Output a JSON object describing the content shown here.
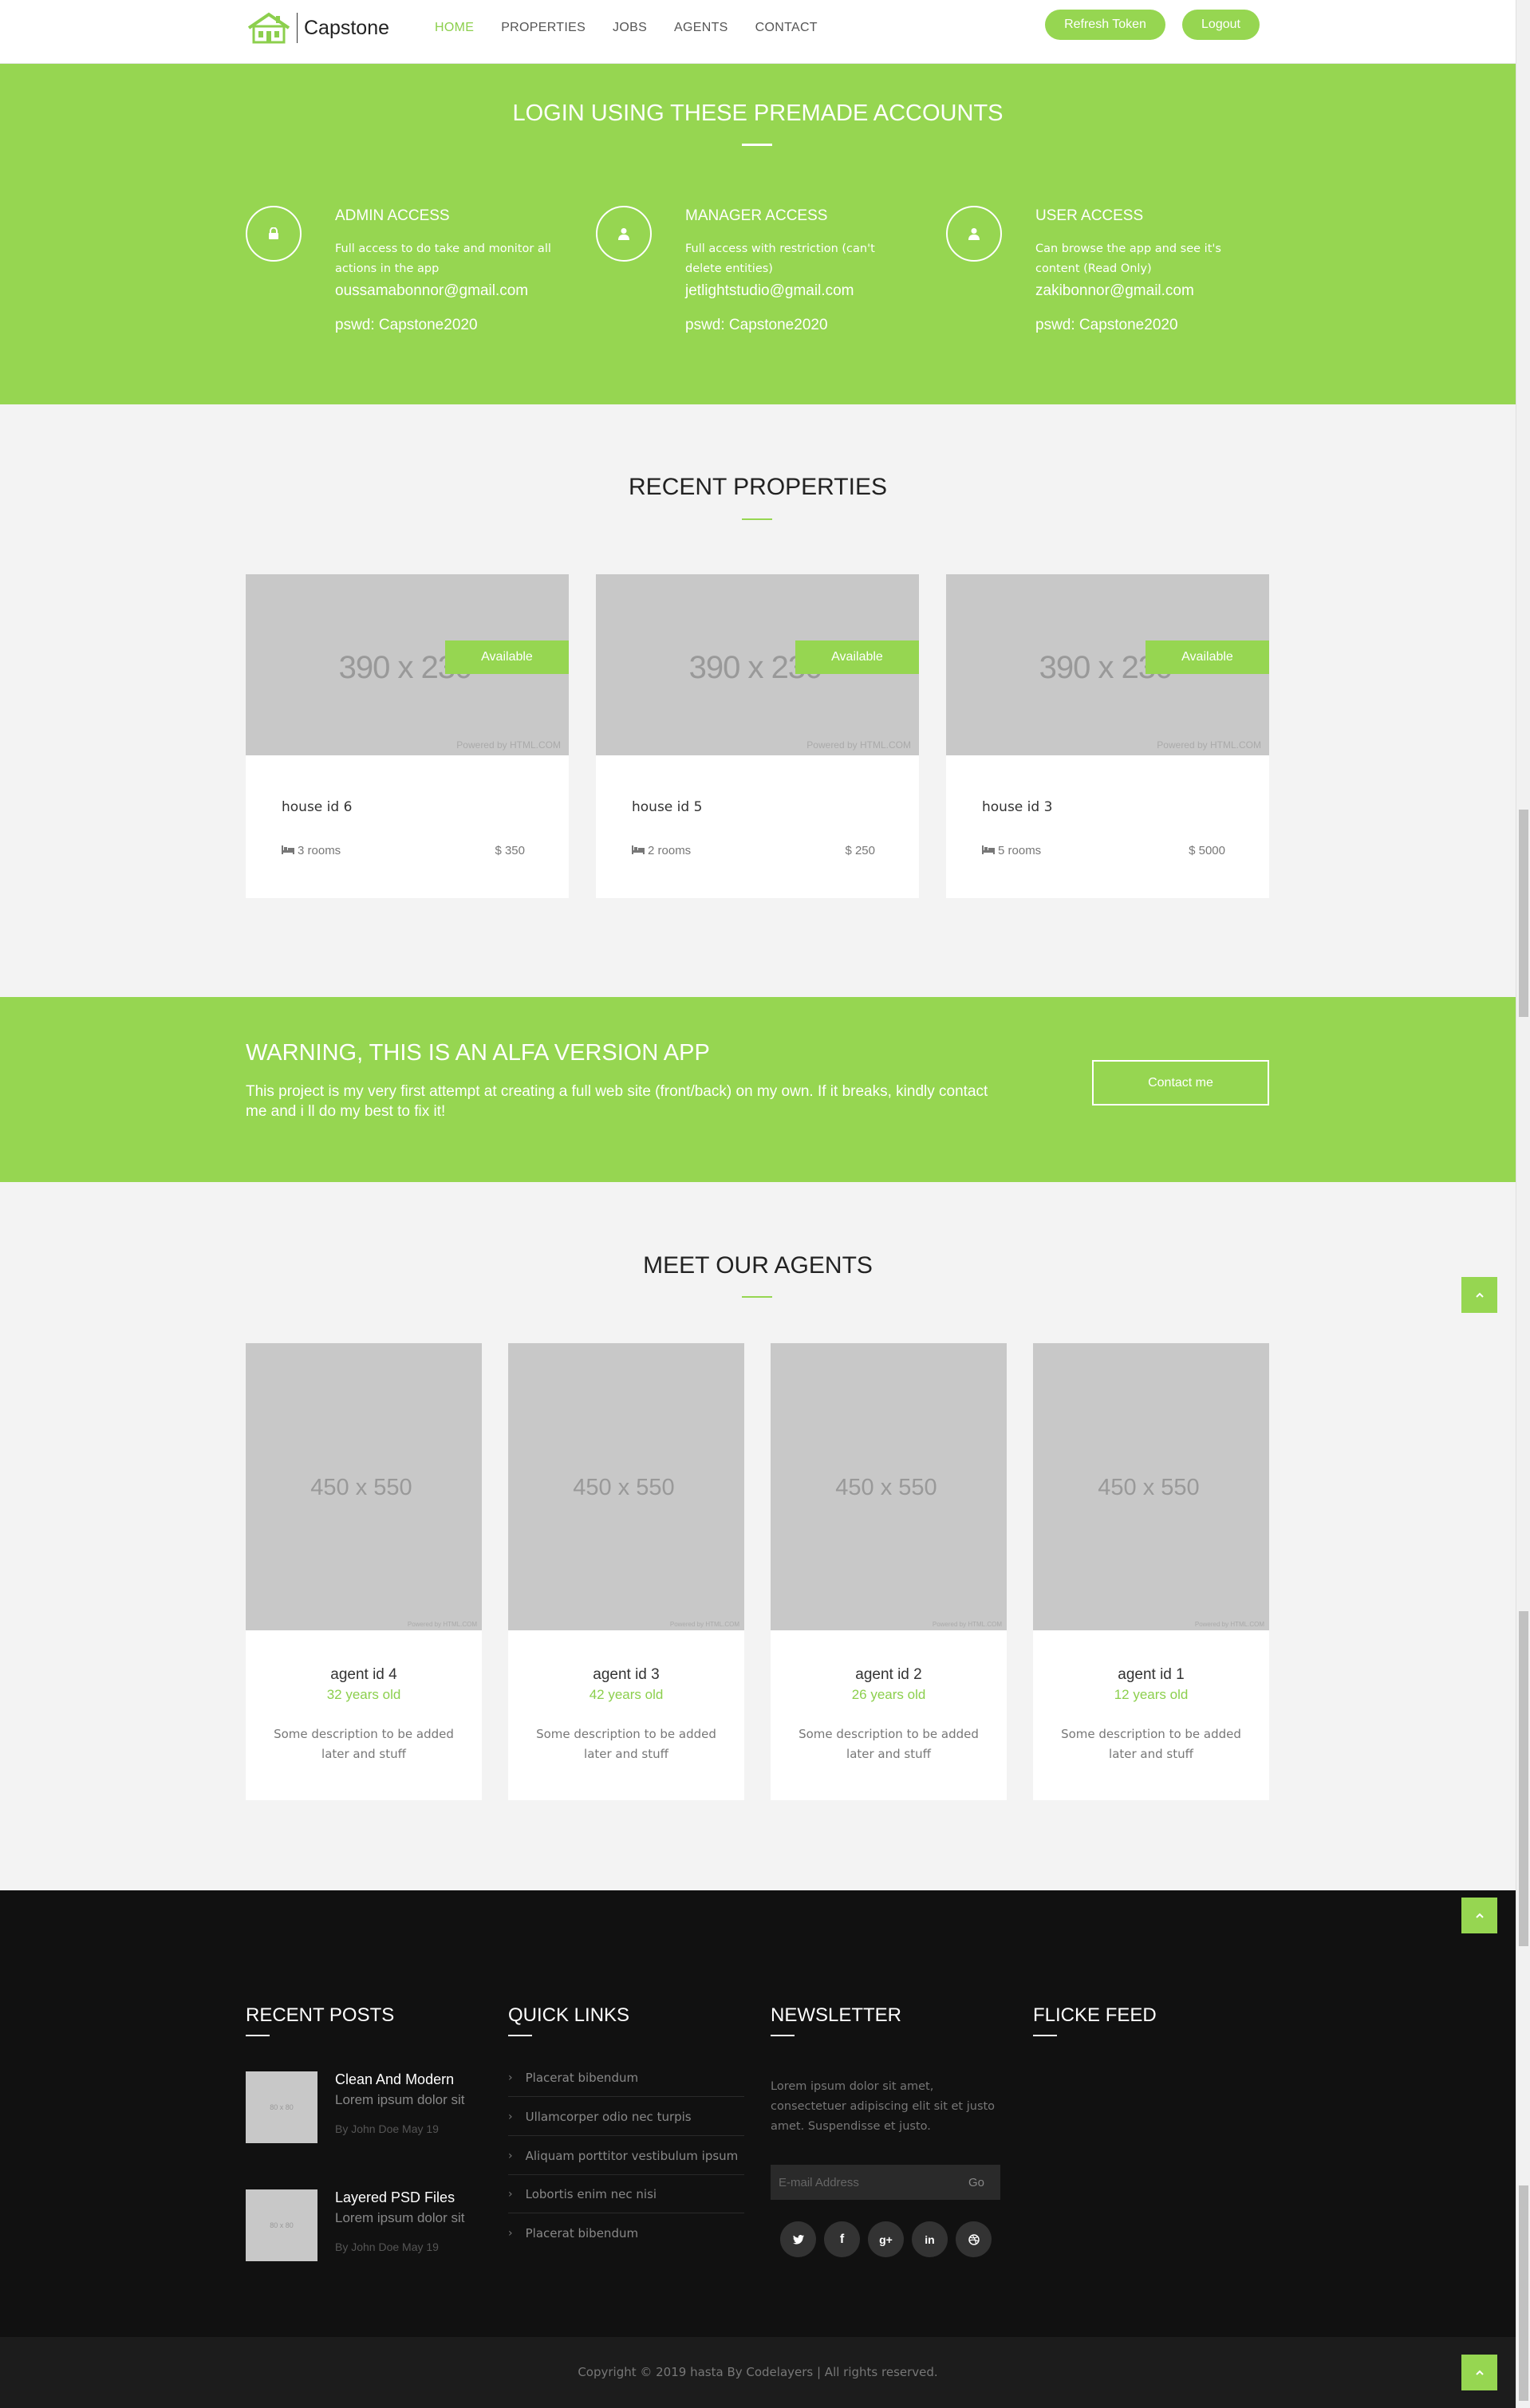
{
  "nav": {
    "logo_text": "Capstone",
    "menu": [
      "HOME",
      "PROPERTIES",
      "JOBS",
      "AGENTS",
      "CONTACT"
    ],
    "active": "HOME",
    "refresh_label": "Refresh Token",
    "logout_label": "Logout"
  },
  "login": {
    "title": "LOGIN USING THESE PREMADE ACCOUNTS",
    "accounts": [
      {
        "title": "ADMIN ACCESS",
        "desc": "Full access to do take and monitor all actions in the app",
        "email": "oussamabonnor@gmail.com",
        "pswd": "pswd: Capstone2020",
        "icon": "lock-icon"
      },
      {
        "title": "MANAGER ACCESS",
        "desc": "Full access with restriction (can't delete entities)",
        "email": "jetlightstudio@gmail.com",
        "pswd": "pswd: Capstone2020",
        "icon": "user-icon"
      },
      {
        "title": "USER ACCESS",
        "desc": "Can browse the app and see it's content (Read Only)",
        "email": "zakibonnor@gmail.com",
        "pswd": "pswd: Capstone2020",
        "icon": "user-icon"
      }
    ]
  },
  "properties": {
    "title": "RECENT PROPERTIES",
    "placeholder": "390 x 230",
    "powered": "Powered by HTML.COM",
    "items": [
      {
        "name": "house id 6",
        "rooms": "3 rooms",
        "price": "$ 350",
        "status": "Available"
      },
      {
        "name": "house id 5",
        "rooms": "2 rooms",
        "price": "$ 250",
        "status": "Available"
      },
      {
        "name": "house id 3",
        "rooms": "5 rooms",
        "price": "$ 5000",
        "status": "Available"
      }
    ]
  },
  "warning": {
    "title": "WARNING, THIS IS AN ALFA VERSION APP",
    "text": "This project is my very first attempt at creating a full web site (front/back) on my own. If it breaks, kindly contact me and i ll do my best to fix it!",
    "button": "Contact me"
  },
  "agents": {
    "title": "MEET OUR AGENTS",
    "placeholder": "450 x 550",
    "powered": "Powered by HTML.COM",
    "items": [
      {
        "name": "agent id 4",
        "age": "32 years old",
        "desc": "Some description to be added later and stuff"
      },
      {
        "name": "agent id 3",
        "age": "42 years old",
        "desc": "Some description to be added later and stuff"
      },
      {
        "name": "agent id 2",
        "age": "26 years old",
        "desc": "Some description to be added later and stuff"
      },
      {
        "name": "agent id 1",
        "age": "12 years old",
        "desc": "Some description to be added later and stuff"
      }
    ]
  },
  "footer": {
    "recent_posts": {
      "title": "RECENT POSTS",
      "thumb": "80 x 80",
      "items": [
        {
          "title": "Clean And Modern",
          "snippet": "Lorem ipsum dolor sit",
          "meta": "By John Doe May 19"
        },
        {
          "title": "Layered PSD Files",
          "snippet": "Lorem ipsum dolor sit",
          "meta": "By John Doe May 19"
        }
      ]
    },
    "quick_links": {
      "title": "QUICK LINKS",
      "items": [
        "Placerat bibendum",
        "Ullamcorper odio nec turpis",
        "Aliquam porttitor vestibulum ipsum",
        "Lobortis enim nec nisi",
        "Placerat bibendum"
      ]
    },
    "newsletter": {
      "title": "NEWSLETTER",
      "text": "Lorem ipsum dolor sit amet, consectetuer adipiscing elit sit et justo amet. Suspendisse et justo.",
      "placeholder": "E-mail Address",
      "go": "Go",
      "social": [
        "twitter-icon",
        "facebook-icon",
        "google-plus-icon",
        "linkedin-icon",
        "dribbble-icon"
      ]
    },
    "flickr": {
      "title": "FLICKE FEED"
    },
    "copyright": "Copyright © 2019 hasta By Codelayers | All rights reserved."
  },
  "colors": {
    "accent": "#96d651",
    "footer_bg": "#111111"
  }
}
